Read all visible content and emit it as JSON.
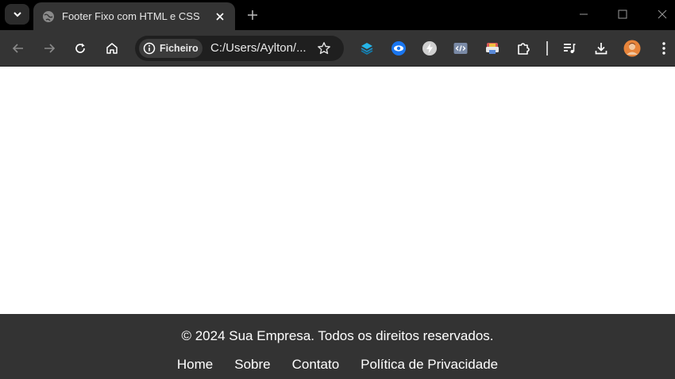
{
  "browser": {
    "tab": {
      "title": "Footer Fixo com HTML e CSS"
    },
    "address_bar": {
      "security_chip_label": "Ficheiro",
      "url": "C:/Users/Aylton/..."
    },
    "icons": {
      "tab_search": "chevron-down-icon",
      "favicon": "globe-icon",
      "tab_close": "close-icon",
      "new_tab": "plus-icon",
      "back": "arrow-left-icon",
      "forward": "arrow-right-icon",
      "reload": "reload-icon",
      "home": "home-icon",
      "info": "info-icon",
      "bookmark": "star-icon",
      "extensions_menu": "puzzle-icon",
      "media": "media-playlist-icon",
      "downloads": "download-icon",
      "profile": "avatar",
      "menu": "kebab-menu-icon"
    },
    "colors": {
      "tabstrip": "#000000",
      "toolbar": "#343434",
      "omnibox": "#1f1f1f"
    }
  },
  "page": {
    "footer": {
      "copyright": "© 2024 Sua Empresa. Todos os direitos reservados.",
      "links": [
        "Home",
        "Sobre",
        "Contato",
        "Política de Privacidade"
      ],
      "background": "#333333",
      "text_color": "#ffffff"
    }
  }
}
